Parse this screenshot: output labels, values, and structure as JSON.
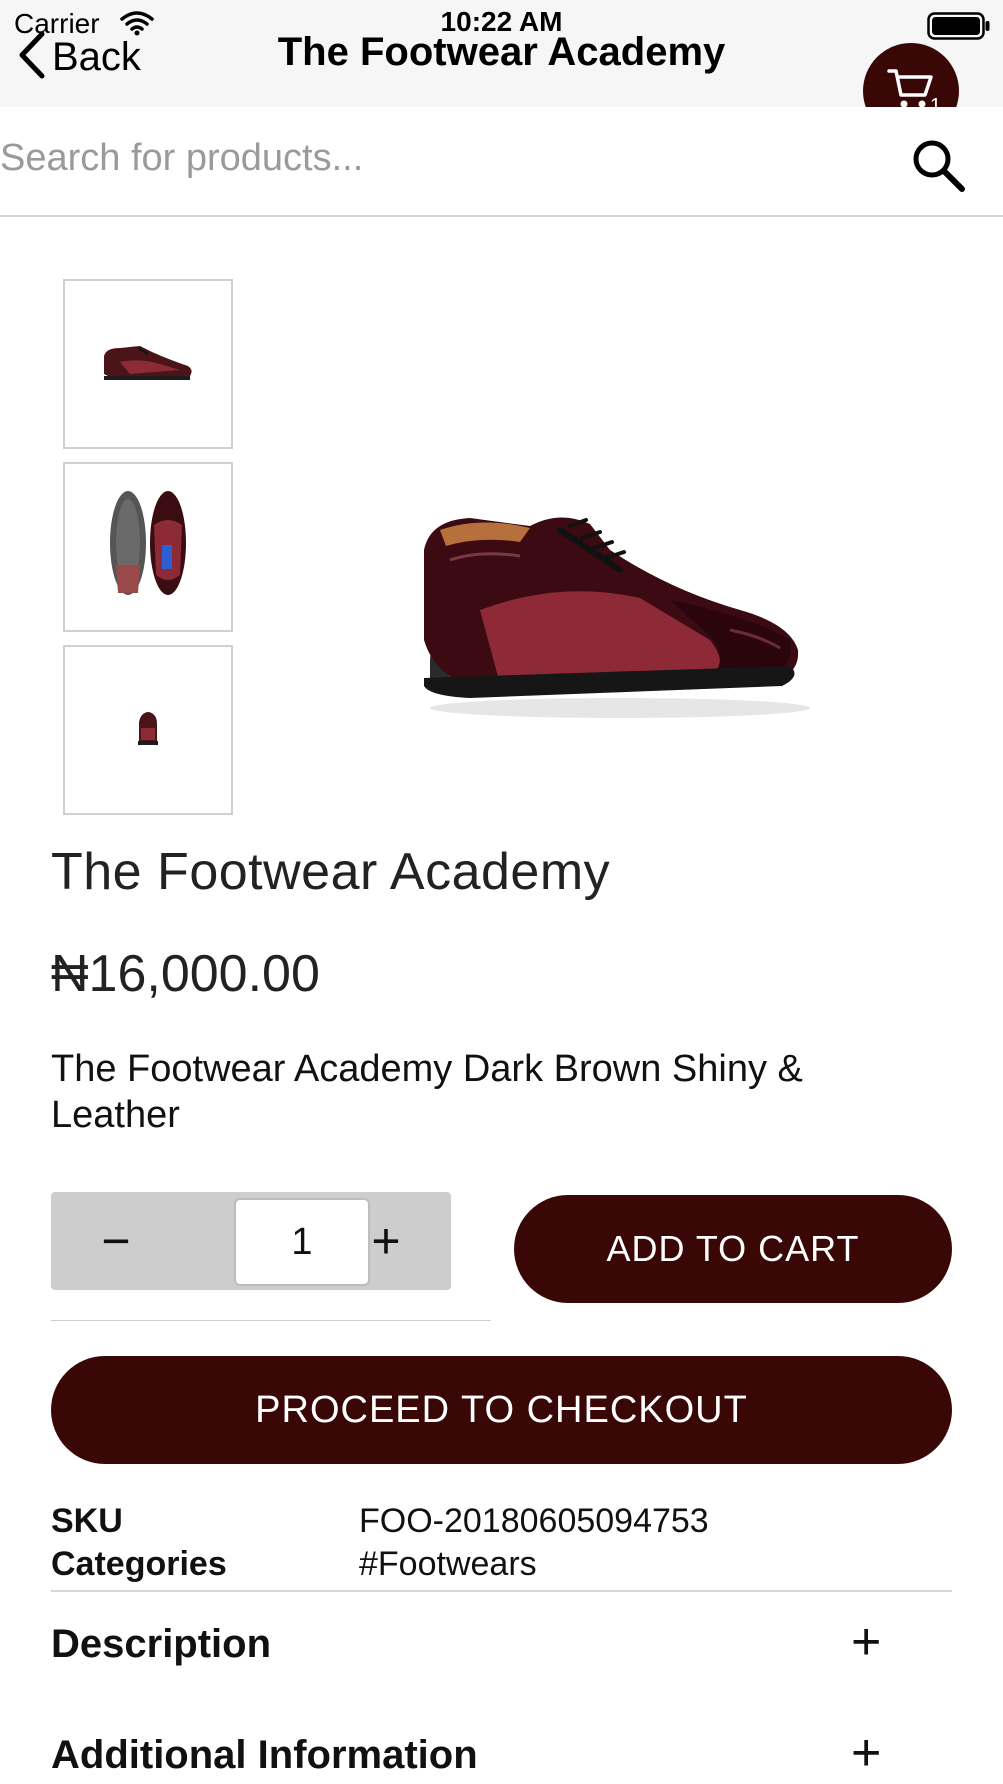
{
  "status_bar": {
    "carrier": "Carrier",
    "time": "10:22 AM",
    "icons": [
      "wifi-icon",
      "battery-icon"
    ]
  },
  "nav": {
    "back_label": "Back",
    "title": "The Footwear Academy",
    "cart_count": "1",
    "cart_icon": "cart-icon"
  },
  "search": {
    "placeholder": "Search for products...",
    "value": "",
    "icon": "search-icon"
  },
  "gallery": {
    "thumbnails": [
      "shoe-side-thumbnail",
      "shoe-sole-top-thumbnail",
      "shoe-back-thumbnail"
    ],
    "main_image": "shoe-main-image"
  },
  "product": {
    "title": "The Footwear Academy",
    "price": "₦16,000.00",
    "description": "The Footwear Academy Dark Brown Shiny & Leather"
  },
  "quantity": {
    "decrement_label": "−",
    "value": "1",
    "increment_label": "+"
  },
  "actions": {
    "add_to_cart": "ADD TO CART",
    "checkout": "PROCEED TO CHECKOUT"
  },
  "meta": {
    "sku_label": "SKU",
    "sku_value": "FOO-20180605094753",
    "categories_label": "Categories",
    "categories_value": "#Footwears"
  },
  "accordions": [
    {
      "label": "Description",
      "toggle": "+"
    },
    {
      "label": "Additional Information",
      "toggle": "+"
    }
  ],
  "colors": {
    "brand": "#3a0707",
    "qty_bg": "#cdcdcd",
    "topbar_bg": "#f6f6f6"
  }
}
